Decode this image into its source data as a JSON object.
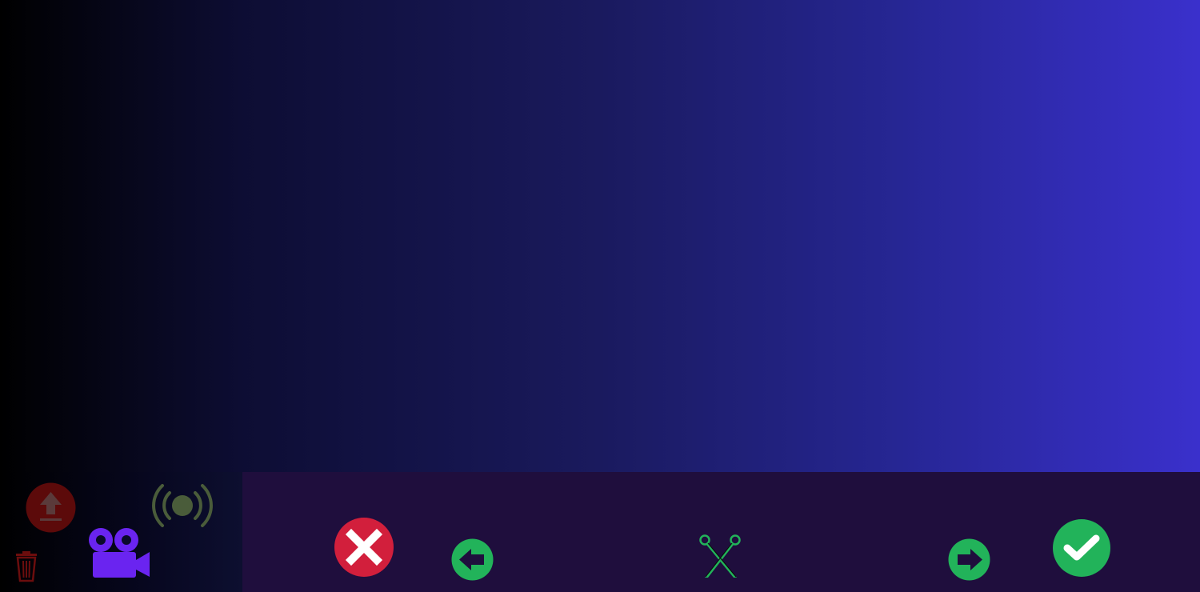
{
  "colors": {
    "background_left": "#000000",
    "background_right": "#3a30cc",
    "edit_bar": "#1f0e3d",
    "upload_disabled": "#5c0a0a",
    "delete_disabled": "#6b0d0d",
    "camera": "#6a24f0",
    "broadcast_disabled": "#4a5c3a",
    "cancel": "#d21f3c",
    "accept": "#22b35a",
    "nav_arrows": "#22b35a",
    "trim": "#22b35a"
  },
  "icons": {
    "upload": "upload-circle-icon",
    "delete": "trash-icon",
    "camera": "video-camera-icon",
    "broadcast": "broadcast-icon",
    "cancel": "cancel-x-icon",
    "previous": "arrow-left-icon",
    "trim": "scissors-icon",
    "next": "arrow-right-icon",
    "accept": "checkmark-icon"
  }
}
